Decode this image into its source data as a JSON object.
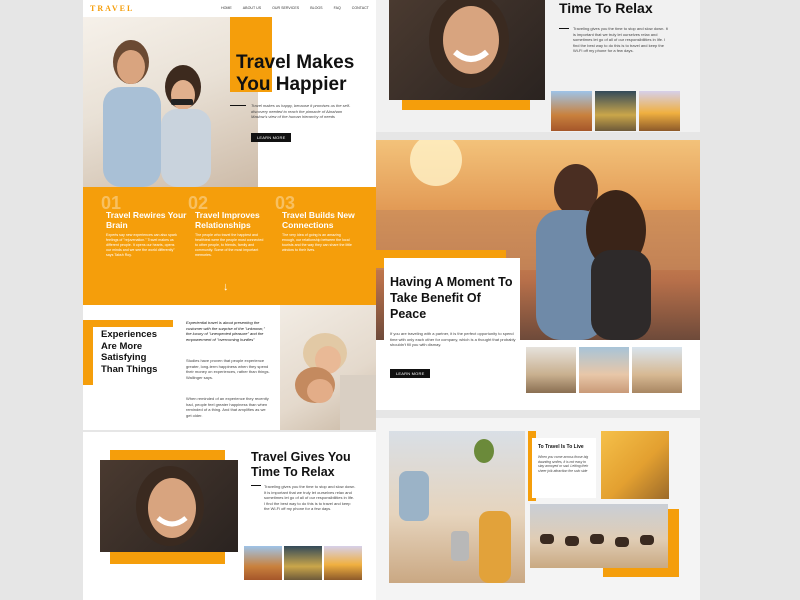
{
  "nav": {
    "logo": "TRAVEL",
    "items": [
      "HOME",
      "ABOUT US",
      "OUR SERVICES",
      "BLOGS",
      "FAQ",
      "CONTACT"
    ]
  },
  "hero": {
    "title_line1": "Travel Makes",
    "title_line2": "You Happier",
    "text": "Travel makes us happy, because it promises us the self-discovery needed to reach the pinnacle of Abraham Maslow's view of the human hierarchy of needs",
    "button": "LEARN MORE"
  },
  "features": [
    {
      "num": "01",
      "title": "Travel Rewires Your Brain",
      "text": "Experts say new experiences can also spark feelings of \"rejuvenation.\" Travel makes us different people. It opens our hearts, opens our minds and we see the world differently\" says Taksh Roy."
    },
    {
      "num": "02",
      "title": "Travel Improves Relationships",
      "text": "The people who travel the happiest and healthiest were the people most connected to other people, to friends, family and community. Some of the most important memories."
    },
    {
      "num": "03",
      "title": "Travel Builds New Connections",
      "text": "The very idea of going is an amazing enough, our relationship between the local tourists and the way they can share the little window to their lives."
    }
  ],
  "experiences": {
    "title_lines": [
      "Experiences",
      "Are More",
      "Satisfying",
      "Than Things"
    ],
    "quote": "Experiential travel is about presenting the customer with the surprise of the \"unknown,\" the luxury of \"unexpected pleasure\" and the empowerment of \"overcoming hurdles\"",
    "text1": "Studies have proven that people experience greater, long-term happiness when they spend their money on experiences, rather than things. Wallinger says.",
    "text2": "When reminded of an experience they recently had, people feel greater happiness than when reminded of a thing. And that amplifies as we get older."
  },
  "relax": {
    "title_line1": "Travel Gives You",
    "title_line2": "Time To Relax",
    "title_top": "Time To Relax",
    "text": "Traveling gives you the time to stop and slow down. It is important that we truly let ourselves relax and sometimes let go of all of our responsibilities in life. I find the best way to do this is to travel and keep the Wi-Fi off my phone for a few days."
  },
  "peace": {
    "title_line1": "Having A Moment To",
    "title_line2": "Take Benefit Of",
    "title_line3": "Peace",
    "text": "If you are traveling with a partner, it is the perfect opportunity to spend time with only each other for company, which is a thought that probably shouldn't fill you with dismay.",
    "button": "LEARN MORE"
  },
  "live": {
    "title": "To Travel Is To Live",
    "text": "When you come across those big daunting smiles, it is not easy to stay annoyed or sad. Letting their sheer joik attraction the solo side"
  },
  "colors": {
    "accent": "#f59e0b",
    "dark": "#111111",
    "background": "#e6e6e6"
  }
}
